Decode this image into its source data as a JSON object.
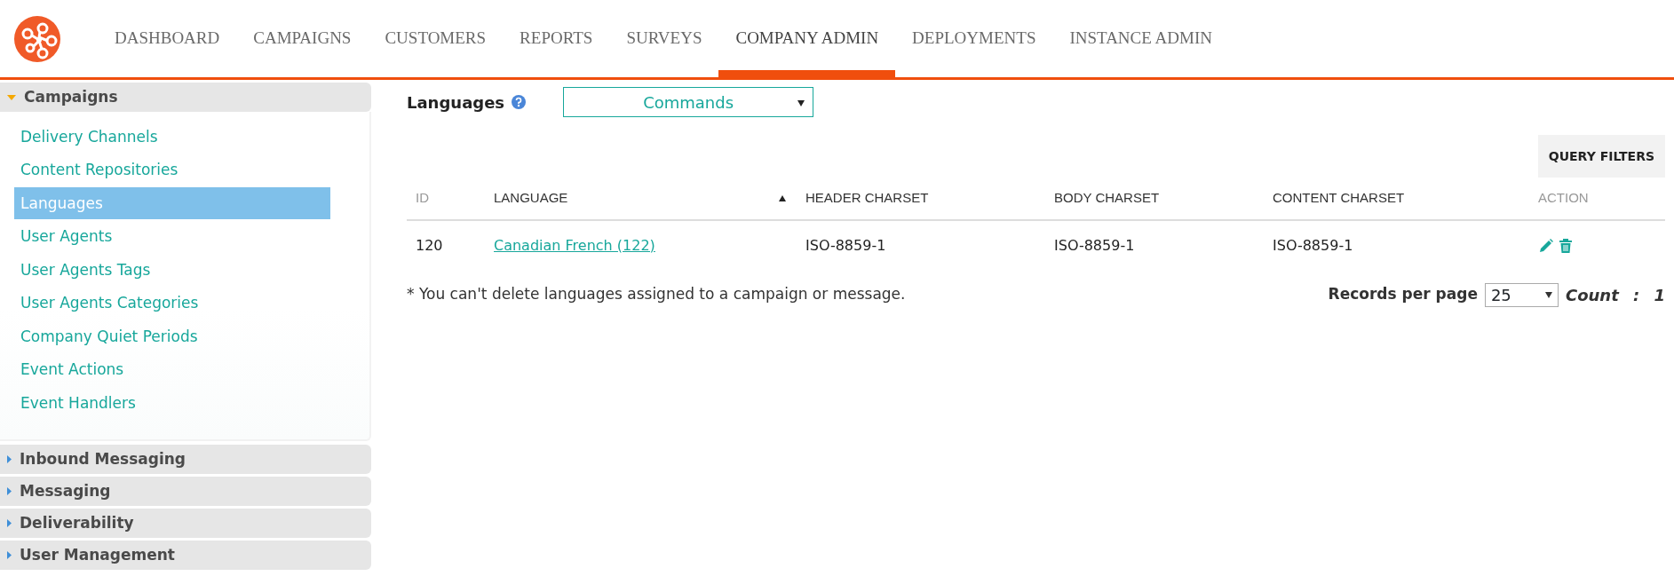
{
  "nav": {
    "tabs": [
      {
        "label": "DASHBOARD",
        "selected": false
      },
      {
        "label": "CAMPAIGNS",
        "selected": false
      },
      {
        "label": "CUSTOMERS",
        "selected": false
      },
      {
        "label": "REPORTS",
        "selected": false
      },
      {
        "label": "SURVEYS",
        "selected": false
      },
      {
        "label": "COMPANY ADMIN",
        "selected": true
      },
      {
        "label": "DEPLOYMENTS",
        "selected": false
      },
      {
        "label": "INSTANCE ADMIN",
        "selected": false
      }
    ]
  },
  "sidebar": {
    "sections": [
      {
        "title": "Campaigns",
        "expanded": true,
        "items": [
          {
            "label": "Delivery Channels",
            "selected": false
          },
          {
            "label": "Content Repositories",
            "selected": false
          },
          {
            "label": "Languages",
            "selected": true
          },
          {
            "label": "User Agents",
            "selected": false
          },
          {
            "label": "User Agents Tags",
            "selected": false
          },
          {
            "label": "User Agents Categories",
            "selected": false
          },
          {
            "label": "Company Quiet Periods",
            "selected": false
          },
          {
            "label": "Event Actions",
            "selected": false
          },
          {
            "label": "Event Handlers",
            "selected": false
          }
        ]
      },
      {
        "title": "Inbound Messaging",
        "expanded": false
      },
      {
        "title": "Messaging",
        "expanded": false
      },
      {
        "title": "Deliverability",
        "expanded": false
      },
      {
        "title": "User Management",
        "expanded": false
      }
    ]
  },
  "main": {
    "title": "Languages",
    "commands": {
      "value": "Commands"
    },
    "query_filters_button": "QUERY FILTERS",
    "table": {
      "columns": [
        {
          "label": "ID",
          "sortable": false,
          "sorted": false
        },
        {
          "label": "LANGUAGE",
          "sortable": true,
          "sorted": true
        },
        {
          "label": "HEADER CHARSET",
          "sortable": true,
          "sorted": false
        },
        {
          "label": "BODY CHARSET",
          "sortable": true,
          "sorted": false
        },
        {
          "label": "CONTENT CHARSET",
          "sortable": true,
          "sorted": false
        },
        {
          "label": "ACTION",
          "sortable": false,
          "sorted": false
        }
      ],
      "rows": [
        {
          "id": "120",
          "language": "Canadian French (122)",
          "header_charset": "ISO-8859-1",
          "body_charset": "ISO-8859-1",
          "content_charset": "ISO-8859-1"
        }
      ]
    },
    "note": "* You can't delete languages assigned to a campaign or message.",
    "records_per_page": {
      "label": "Records per page",
      "value": "25"
    },
    "count": {
      "label": "Count",
      "separator": ":",
      "value": "1"
    }
  }
}
